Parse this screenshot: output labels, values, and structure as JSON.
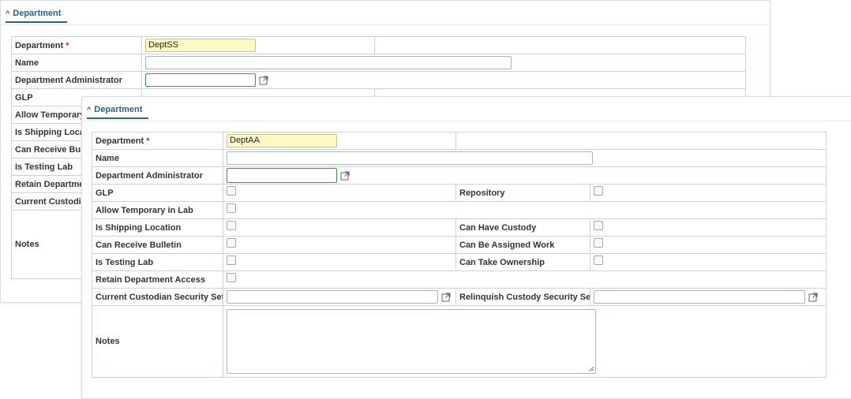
{
  "back_panel": {
    "section_title": "Department",
    "rows": {
      "department_label": "Department",
      "department_value": "DeptSS",
      "name_label": "Name",
      "name_value": "",
      "admin_label": "Department Administrator",
      "admin_value": "",
      "glp_label": "GLP",
      "allow_temp_label": "Allow Temporary",
      "shipping_label": "Is Shipping Locat",
      "bulletin_label": "Can Receive Bull",
      "testing_label": "Is Testing Lab",
      "retain_label": "Retain Departme",
      "custodian_label": "Current Custodia",
      "notes_label": "Notes"
    }
  },
  "front_panel": {
    "section_title": "Department",
    "department_label": "Department",
    "required_mark": "*",
    "department_value": "DeptAA",
    "name_label": "Name",
    "name_value": "",
    "admin_label": "Department Administrator",
    "admin_value": "",
    "glp_label": "GLP",
    "repository_label": "Repository",
    "allow_temp_label": "Allow Temporary in Lab",
    "shipping_label": "Is Shipping Location",
    "custody_label": "Can Have Custody",
    "bulletin_label": "Can Receive Bulletin",
    "assigned_label": "Can Be Assigned Work",
    "testing_label": "Is Testing Lab",
    "ownership_label": "Can Take Ownership",
    "retain_label": "Retain Department Access",
    "custodian_label": "Current Custodian Security Set",
    "custodian_value": "",
    "relinquish_label": "Relinquish Custody Security Set",
    "relinquish_value": "",
    "notes_label": "Notes",
    "notes_value": ""
  },
  "icons": {
    "collapse": "chevron-up-icon",
    "open_external": "external-link-icon"
  },
  "colors": {
    "accent": "#2d5f8f",
    "required": "#dd2222",
    "key_field_bg": "#fdf9c4",
    "lookup_border": "#3c9a3c"
  }
}
